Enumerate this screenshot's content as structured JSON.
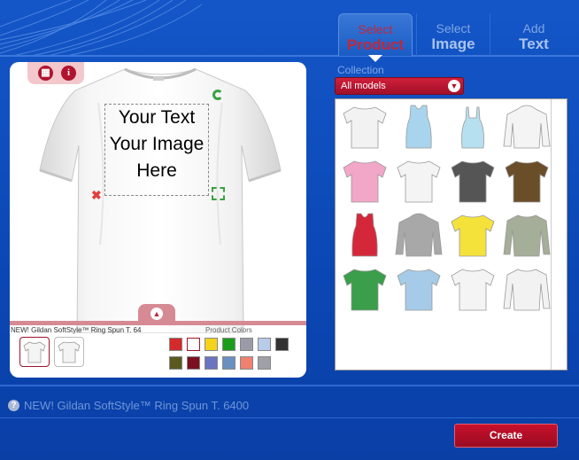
{
  "header": {
    "steps": [
      {
        "line1": "Select",
        "line2": "Product",
        "active": true
      },
      {
        "line1": "Select",
        "line2": "Image",
        "active": false
      },
      {
        "line1": "Add",
        "line2": "Text",
        "active": false
      }
    ]
  },
  "canvas": {
    "placeholder_lines": [
      "Your Text",
      "Your Image",
      "Here"
    ],
    "product_label": "NEW!  Gildan SoftStyle™ Ring Spun T. 64",
    "colors_label": "Product Colors",
    "colors": [
      "#d42a2a",
      "#ffffff",
      "#f5d31a",
      "#1a9e1a",
      "#9a9aa8",
      "#b8cce8",
      "#333333",
      "#5a5a20",
      "#7a1020",
      "#6a74c0",
      "#6a90c0",
      "#f08070",
      "#a0a0a8"
    ],
    "selected_color_index": 1
  },
  "collection": {
    "label": "Collection",
    "selected": "All models"
  },
  "models": [
    {
      "name": "white-tee",
      "color": "#f2f2f2"
    },
    {
      "name": "light-blue-tank",
      "color": "#a9d4ee"
    },
    {
      "name": "light-blue-camisole",
      "color": "#b6e0f0"
    },
    {
      "name": "white-hoodie",
      "color": "#f4f4f4"
    },
    {
      "name": "pink-tee",
      "color": "#f2a6c8"
    },
    {
      "name": "white-womens-vneck",
      "color": "#f4f4f4"
    },
    {
      "name": "charcoal-ringer-tee",
      "color": "#555555"
    },
    {
      "name": "brown-ringer-tee",
      "color": "#6a4e2a"
    },
    {
      "name": "red-tank",
      "color": "#d4283a"
    },
    {
      "name": "gray-hoodie",
      "color": "#a8a8a8"
    },
    {
      "name": "yellow-tee",
      "color": "#f4e23a"
    },
    {
      "name": "sage-long-sleeve",
      "color": "#a4ae98"
    },
    {
      "name": "green-womens-tee",
      "color": "#3a9e4a"
    },
    {
      "name": "light-blue-polo",
      "color": "#a6cbe8"
    },
    {
      "name": "white-womens-tee",
      "color": "#f4f4f4"
    },
    {
      "name": "white-raglan",
      "color": "#f2f2f2"
    }
  ],
  "footer": {
    "help_glyph": "?",
    "product_name": "NEW!  Gildan SoftStyle™ Ring Spun T. 6400",
    "create_label": "Create"
  }
}
